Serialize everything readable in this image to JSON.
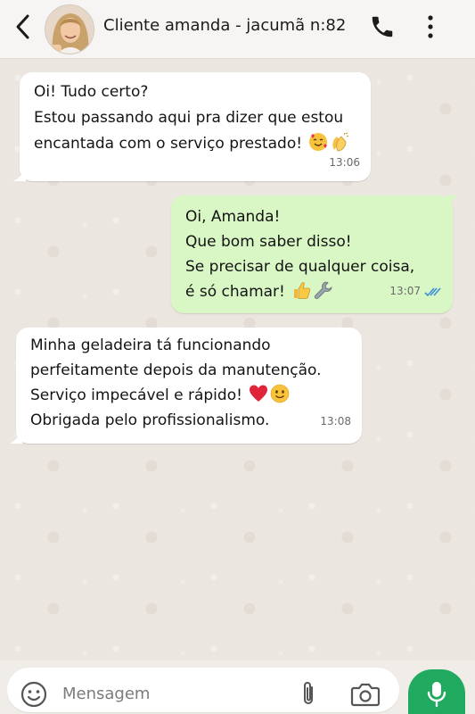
{
  "header": {
    "contact_name": "Cliente amanda - jacumã n:82",
    "icons": [
      "back-arrow-icon",
      "phone-icon",
      "more-vert-icon"
    ]
  },
  "messages": [
    {
      "direction": "in",
      "lines": [
        "Oi! Tudo certo?",
        "Estou passando aqui pra dizer que estou",
        "encantada com o serviço prestado!"
      ],
      "emojis": [
        "smiling-face-with-hearts-emoji",
        "clapping-hands-emoji"
      ],
      "time": "13:06"
    },
    {
      "direction": "out",
      "lines": [
        "Oi, Amanda!",
        "Que bom saber disso!",
        "Se precisar de qualquer coisa,",
        "é só chamar!"
      ],
      "emojis": [
        "thumbs-up-emoji",
        "wrench-emoji"
      ],
      "time": "13:07",
      "status": "read"
    },
    {
      "direction": "in",
      "lines": [
        "Minha geladeira tá funcionando",
        "perfeitamente depois da manutenção.",
        "Serviço impecável e rápido!",
        "Obrigada pelo profissionalismo."
      ],
      "emojis": [
        "red-heart-emoji",
        "smiling-face-emoji"
      ],
      "time": "13:08"
    }
  ],
  "input": {
    "placeholder": "Mensagem"
  },
  "colors": {
    "incoming_bubble": "#ffffff",
    "outgoing_bubble": "#d9f6c5",
    "mic_button": "#1faa5f",
    "read_ticks": "#3b8fd6"
  }
}
